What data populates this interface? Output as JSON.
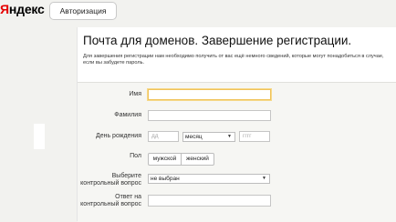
{
  "header": {
    "logo_first": "Я",
    "logo_rest": "ндекс",
    "auth_tab": "Авторизация"
  },
  "page": {
    "title": "Почта для доменов. Завершение регистрации.",
    "intro": "Для завершения регистрации нам необходимо получить от вас ещё немного сведений, которые могут понадобиться в случае, если вы забудете пароль."
  },
  "form": {
    "first_name": {
      "label": "Имя",
      "value": ""
    },
    "last_name": {
      "label": "Фамилия",
      "value": ""
    },
    "birthday": {
      "label": "День рождения",
      "day_placeholder": "дд",
      "month_selected": "месяц",
      "year_placeholder": "гггг"
    },
    "gender": {
      "label": "Пол",
      "male": "мужской",
      "female": "женский"
    },
    "question": {
      "label": "Выберите контрольный вопрос",
      "selected": "не выбран"
    },
    "answer": {
      "label": "Ответ на контрольный вопрос",
      "value": ""
    }
  }
}
